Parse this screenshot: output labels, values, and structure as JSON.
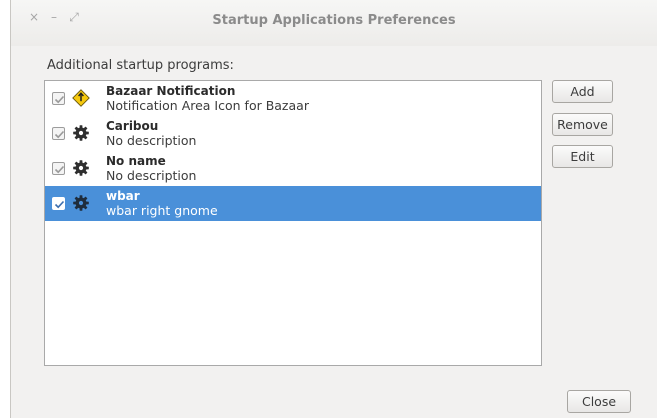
{
  "window": {
    "title": "Startup Applications Preferences",
    "controls": {
      "close": "×",
      "minimize": "–",
      "maximize": "⤢"
    }
  },
  "section_label": "Additional startup programs:",
  "programs": [
    {
      "name": "Bazaar Notification",
      "description": "Notification Area Icon for Bazaar",
      "checked": true,
      "icon": "bazaar-warning-icon",
      "selected": false
    },
    {
      "name": "Caribou",
      "description": "No description",
      "checked": true,
      "icon": "gear-icon",
      "selected": false
    },
    {
      "name": "No name",
      "description": "No description",
      "checked": true,
      "icon": "gear-icon",
      "selected": false
    },
    {
      "name": "wbar",
      "description": "wbar right gnome",
      "checked": true,
      "icon": "gear-icon",
      "selected": true
    }
  ],
  "buttons": {
    "add": "Add",
    "remove": "Remove",
    "edit": "Edit",
    "close": "Close"
  },
  "colors": {
    "selection": "#4a90d9",
    "window_bg": "#f2f1f0",
    "bazaar_icon": "#f6c90e"
  }
}
